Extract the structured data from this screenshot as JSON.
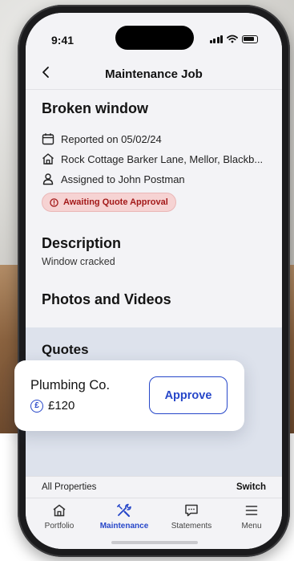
{
  "status_bar": {
    "time": "9:41"
  },
  "header": {
    "title": "Maintenance Job"
  },
  "job": {
    "title": "Broken window",
    "reported": "Reported on 05/02/24",
    "address": "Rock Cottage Barker Lane, Mellor, Blackb...",
    "assigned": "Assigned to John Postman",
    "status_badge": "Awaiting Quote Approval"
  },
  "description": {
    "heading": "Description",
    "text": "Window cracked"
  },
  "photos": {
    "heading": "Photos and Videos"
  },
  "quotes": {
    "heading": "Quotes",
    "items": [
      {
        "company": "Plumbing Co.",
        "amount": "£120",
        "action_label": "Approve"
      }
    ]
  },
  "properties_bar": {
    "label": "All Properties",
    "switch_label": "Switch"
  },
  "tabs": [
    {
      "label": "Portfolio",
      "icon": "home-icon"
    },
    {
      "label": "Maintenance",
      "icon": "tools-icon"
    },
    {
      "label": "Statements",
      "icon": "message-icon"
    },
    {
      "label": "Menu",
      "icon": "menu-icon"
    }
  ],
  "colors": {
    "accent": "#2747c9",
    "badge_bg": "#f6d3d3",
    "badge_text": "#a31919",
    "quotes_bg": "#dde2ec"
  }
}
